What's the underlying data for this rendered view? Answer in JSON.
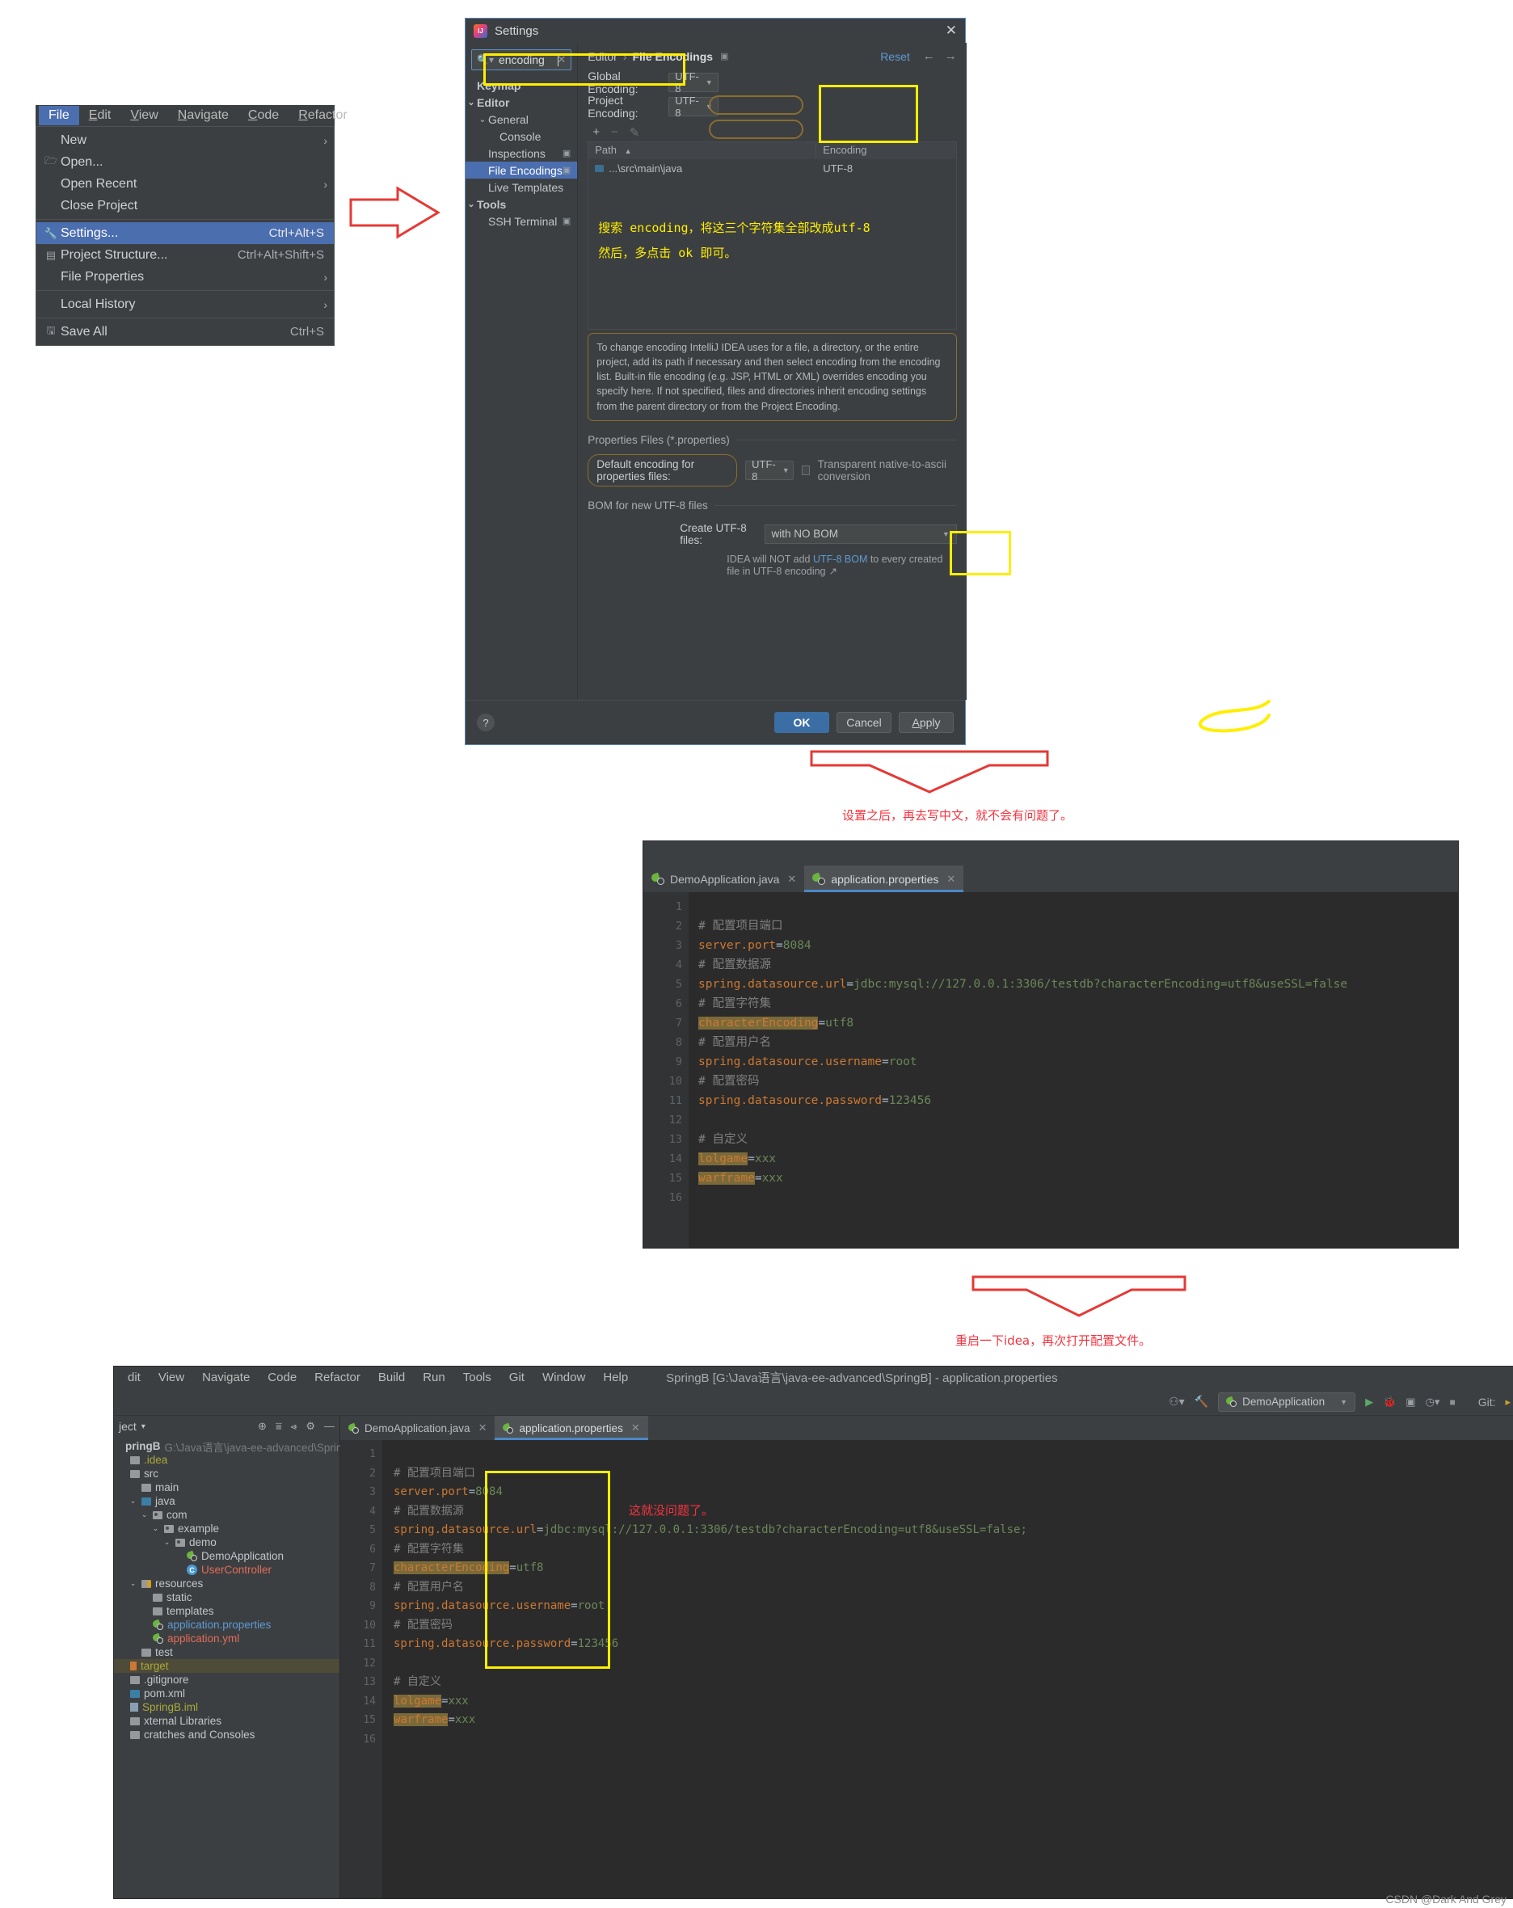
{
  "file_menu": {
    "menubar": [
      "File",
      "Edit",
      "View",
      "Navigate",
      "Code",
      "Refactor"
    ],
    "items": [
      {
        "label": "New",
        "accel": "",
        "arrow": "›",
        "icon": ""
      },
      {
        "label": "Open...",
        "accel": "",
        "arrow": "",
        "icon": "folder-open-icon"
      },
      {
        "label": "Open Recent",
        "accel": "",
        "arrow": "›",
        "icon": ""
      },
      {
        "label": "Close Project",
        "accel": "",
        "arrow": "",
        "icon": ""
      },
      {
        "label": "Settings...",
        "accel": "Ctrl+Alt+S",
        "arrow": "",
        "icon": "wrench-icon"
      },
      {
        "label": "Project Structure...",
        "accel": "Ctrl+Alt+Shift+S",
        "arrow": "",
        "icon": "module-icon"
      },
      {
        "label": "File Properties",
        "accel": "",
        "arrow": "›",
        "icon": ""
      },
      {
        "label": "Local History",
        "accel": "",
        "arrow": "›",
        "icon": ""
      },
      {
        "label": "Save All",
        "accel": "Ctrl+S",
        "arrow": "",
        "icon": "save-icon"
      }
    ]
  },
  "settings": {
    "title": "Settings",
    "close_label": "✕",
    "search": {
      "value": "encoding",
      "placeholder": "Search settings",
      "clear_label": "✕"
    },
    "tree": [
      {
        "label": "Keymap",
        "indent": 0,
        "chev": "",
        "bold": true,
        "selected": false,
        "trailing": ""
      },
      {
        "label": "Editor",
        "indent": 0,
        "chev": "⌄",
        "bold": true,
        "selected": false,
        "trailing": ""
      },
      {
        "label": "General",
        "indent": 1,
        "chev": "⌄",
        "bold": false,
        "selected": false,
        "trailing": ""
      },
      {
        "label": "Console",
        "indent": 2,
        "chev": "",
        "bold": false,
        "selected": false,
        "trailing": ""
      },
      {
        "label": "Inspections",
        "indent": 1,
        "chev": "",
        "bold": false,
        "selected": false,
        "trailing": "▣"
      },
      {
        "label": "File Encodings",
        "indent": 1,
        "chev": "",
        "bold": false,
        "selected": true,
        "trailing": "▣"
      },
      {
        "label": "Live Templates",
        "indent": 1,
        "chev": "",
        "bold": false,
        "selected": false,
        "trailing": ""
      },
      {
        "label": "Tools",
        "indent": 0,
        "chev": "⌄",
        "bold": true,
        "selected": false,
        "trailing": ""
      },
      {
        "label": "SSH Terminal",
        "indent": 1,
        "chev": "",
        "bold": false,
        "selected": false,
        "trailing": "▣"
      }
    ],
    "breadcrumb": {
      "crumb1": "Editor",
      "sep": "›",
      "crumb2": "File Encodings",
      "icon": "▣"
    },
    "reset_label": "Reset",
    "nav_back": "←",
    "nav_forward": "→",
    "global_encoding_label": "Global Encoding:",
    "global_encoding_value": "UTF-8",
    "project_encoding_label": "Project Encoding:",
    "project_encoding_value": "UTF-8",
    "table_toolbar": {
      "add": "+",
      "remove": "−",
      "edit": "✎"
    },
    "table": {
      "headers": [
        "Path",
        "Encoding"
      ],
      "sort_arrow": "▲",
      "rows": [
        {
          "path": "...\\src\\main\\java",
          "encoding": "UTF-8"
        }
      ]
    },
    "note_line1": "搜索 encoding，将这三个字符集全部改成utf-8",
    "note_line2": "然后，多点击 ok 即可。",
    "info_text": "To change encoding IntelliJ IDEA uses for a file, a directory, or the entire project, add its path if necessary and then select encoding from the encoding list. Built-in file encoding (e.g. JSP, HTML or XML) overrides encoding you specify here. If not specified, files and directories inherit encoding settings from the parent directory or from the Project Encoding.",
    "properties_section_title": "Properties Files (*.properties)",
    "default_properties_label": "Default encoding for properties files:",
    "default_properties_value": "UTF-8",
    "transparent_label": "Transparent native-to-ascii conversion",
    "bom_section_title": "BOM for new UTF-8 files",
    "create_utf8_label": "Create UTF-8 files:",
    "create_utf8_value": "with NO BOM",
    "bom_note_pre": "IDEA will NOT add ",
    "bom_note_link": "UTF-8 BOM",
    "bom_note_post": " to every created file in UTF-8 encoding",
    "bom_note_icon": "↗",
    "help_label": "?",
    "ok_label": "OK",
    "cancel_label": "Cancel",
    "apply_label": "Apply"
  },
  "annotations": {
    "after_settings": "设置之后，再去写中文，就不会有问题了。",
    "restart_idea": "重启一下idea，再次打开配置文件。",
    "no_problem": "这就没问题了。"
  },
  "mid_editor": {
    "tabs": [
      {
        "label": "DemoApplication.java",
        "icon": "spring-run-icon",
        "active": false,
        "close": "✕"
      },
      {
        "label": "application.properties",
        "icon": "spring-leaf-icon",
        "active": true,
        "close": "✕"
      }
    ],
    "line_numbers": [
      "1",
      "2",
      "3",
      "4",
      "5",
      "6",
      "7",
      "8",
      "9",
      "10",
      "11",
      "12",
      "13",
      "14",
      "15",
      "16"
    ],
    "lines": [
      {
        "n": 1,
        "type": "blank",
        "text": ""
      },
      {
        "n": 2,
        "type": "comment",
        "text": "# 配置项目端口"
      },
      {
        "n": 3,
        "type": "kv",
        "key": "server.port",
        "value": "8084",
        "highlight": false
      },
      {
        "n": 4,
        "type": "comment",
        "text": "# 配置数据源"
      },
      {
        "n": 5,
        "type": "kv",
        "key": "spring.datasource.url",
        "value": "jdbc:mysql://127.0.0.1:3306/testdb?characterEncoding=utf8&useSSL=false",
        "highlight": false
      },
      {
        "n": 6,
        "type": "comment",
        "text": "# 配置字符集"
      },
      {
        "n": 7,
        "type": "kv",
        "key": "characterEncoding",
        "value": "utf8",
        "highlight": true
      },
      {
        "n": 8,
        "type": "comment",
        "text": "# 配置用户名"
      },
      {
        "n": 9,
        "type": "kv",
        "key": "spring.datasource.username",
        "value": "root",
        "highlight": false
      },
      {
        "n": 10,
        "type": "comment",
        "text": "# 配置密码"
      },
      {
        "n": 11,
        "type": "kv",
        "key": "spring.datasource.password",
        "value": "123456",
        "highlight": false
      },
      {
        "n": 12,
        "type": "blank",
        "text": ""
      },
      {
        "n": 13,
        "type": "comment",
        "text": "# 自定义"
      },
      {
        "n": 14,
        "type": "kv",
        "key": "lolgame",
        "value": "xxx",
        "highlight": true
      },
      {
        "n": 15,
        "type": "kv",
        "key": "warframe",
        "value": "xxx",
        "highlight": true
      },
      {
        "n": 16,
        "type": "blank",
        "text": ""
      }
    ]
  },
  "ide": {
    "menubar": [
      "dit",
      "View",
      "Navigate",
      "Code",
      "Refactor",
      "Build",
      "Run",
      "Tools",
      "Git",
      "Window",
      "Help"
    ],
    "window_title": "SpringB [G:\\Java语言\\java-ee-advanced\\SpringB] - application.properties",
    "toolbar": {
      "vcs_icon": "vcs-icon",
      "build_icon": "hammer-icon",
      "run_config": "DemoApplication",
      "run_icon": "▶",
      "debug_icon": "🐞",
      "coverage_icon": "⚙",
      "stop_icon": "■",
      "git_label": "Git:"
    },
    "project_pane": {
      "title": "ject",
      "dropdown": "▾",
      "tool_icons": [
        "locate-icon",
        "expand-all-icon",
        "collapse-all-icon",
        "settings-gear-icon",
        "hide-icon"
      ],
      "tree": [
        {
          "label": "pringB",
          "sub": "G:\\Java语言\\java-ee-advanced\\SpringB",
          "indent": 0,
          "chev": "",
          "icon": "project-icon",
          "color": "white",
          "bold": true,
          "selected": false
        },
        {
          "label": ".idea",
          "sub": "",
          "indent": 0,
          "chev": "",
          "icon": "folder-grey",
          "color": "olive",
          "bold": false,
          "selected": false
        },
        {
          "label": "src",
          "sub": "",
          "indent": 0,
          "chev": "",
          "icon": "folder-grey",
          "color": "normal",
          "bold": false,
          "selected": false
        },
        {
          "label": "main",
          "sub": "",
          "indent": 1,
          "chev": "",
          "icon": "folder-grey",
          "color": "normal",
          "bold": false,
          "selected": false
        },
        {
          "label": "java",
          "sub": "",
          "indent": 1,
          "chev": "⌄",
          "icon": "folder-blue",
          "color": "normal",
          "bold": false,
          "selected": false
        },
        {
          "label": "com",
          "sub": "",
          "indent": 2,
          "chev": "⌄",
          "icon": "package",
          "color": "normal",
          "bold": false,
          "selected": false
        },
        {
          "label": "example",
          "sub": "",
          "indent": 3,
          "chev": "⌄",
          "icon": "package",
          "color": "normal",
          "bold": false,
          "selected": false
        },
        {
          "label": "demo",
          "sub": "",
          "indent": 4,
          "chev": "⌄",
          "icon": "package",
          "color": "normal",
          "bold": false,
          "selected": false
        },
        {
          "label": "DemoApplication",
          "sub": "",
          "indent": 5,
          "chev": "",
          "icon": "spring-run",
          "color": "normal",
          "bold": false,
          "selected": false
        },
        {
          "label": "UserController",
          "sub": "",
          "indent": 5,
          "chev": "",
          "icon": "class",
          "color": "red",
          "bold": false,
          "selected": false
        },
        {
          "label": "resources",
          "sub": "",
          "indent": 1,
          "chev": "⌄",
          "icon": "folder-res",
          "color": "normal",
          "bold": false,
          "selected": false
        },
        {
          "label": "static",
          "sub": "",
          "indent": 2,
          "chev": "",
          "icon": "folder-grey",
          "color": "normal",
          "bold": false,
          "selected": false
        },
        {
          "label": "templates",
          "sub": "",
          "indent": 2,
          "chev": "",
          "icon": "folder-grey",
          "color": "normal",
          "bold": false,
          "selected": false
        },
        {
          "label": "application.properties",
          "sub": "",
          "indent": 2,
          "chev": "",
          "icon": "spring-leaf",
          "color": "blue",
          "bold": false,
          "selected": false
        },
        {
          "label": "application.yml",
          "sub": "",
          "indent": 2,
          "chev": "",
          "icon": "spring-leaf",
          "color": "red",
          "bold": false,
          "selected": false
        },
        {
          "label": "test",
          "sub": "",
          "indent": 1,
          "chev": "",
          "icon": "folder-grey",
          "color": "normal",
          "bold": false,
          "selected": false
        },
        {
          "label": "target",
          "sub": "",
          "indent": 0,
          "chev": "",
          "icon": "folder-orange",
          "color": "olive",
          "bold": false,
          "selected": true
        },
        {
          "label": ".gitignore",
          "sub": "",
          "indent": 0,
          "chev": "",
          "icon": "git-file",
          "color": "normal",
          "bold": false,
          "selected": false
        },
        {
          "label": "pom.xml",
          "sub": "",
          "indent": 0,
          "chev": "",
          "icon": "maven-file",
          "color": "normal",
          "bold": false,
          "selected": false
        },
        {
          "label": "SpringB.iml",
          "sub": "",
          "indent": 0,
          "chev": "",
          "icon": "module-file",
          "color": "olive",
          "bold": false,
          "selected": false
        },
        {
          "label": "xternal Libraries",
          "sub": "",
          "indent": 0,
          "chev": "",
          "icon": "library",
          "color": "normal",
          "bold": false,
          "selected": false
        },
        {
          "label": "cratches and Consoles",
          "sub": "",
          "indent": 0,
          "chev": "",
          "icon": "scratch",
          "color": "normal",
          "bold": false,
          "selected": false
        }
      ]
    },
    "editor": {
      "tabs": [
        {
          "label": "DemoApplication.java",
          "icon": "spring-run-icon",
          "active": false,
          "close": "✕"
        },
        {
          "label": "application.properties",
          "icon": "spring-leaf-icon",
          "active": true,
          "close": "✕"
        }
      ],
      "lines": [
        {
          "n": 1,
          "type": "blank",
          "text": ""
        },
        {
          "n": 2,
          "type": "comment",
          "text": "# 配置项目端口"
        },
        {
          "n": 3,
          "type": "kv",
          "key": "server.port",
          "value": "8084",
          "highlight": false
        },
        {
          "n": 4,
          "type": "comment",
          "text": "# 配置数据源"
        },
        {
          "n": 5,
          "type": "kv",
          "key": "spring.datasource.url",
          "value": "jdbc:mysql://127.0.0.1:3306/testdb?characterEncoding=utf8&useSSL=false;",
          "highlight": false
        },
        {
          "n": 6,
          "type": "comment",
          "text": "# 配置字符集"
        },
        {
          "n": 7,
          "type": "kv",
          "key": "characterEncoding",
          "value": "utf8",
          "highlight": true
        },
        {
          "n": 8,
          "type": "comment",
          "text": "# 配置用户名"
        },
        {
          "n": 9,
          "type": "kv",
          "key": "spring.datasource.username",
          "value": "root",
          "highlight": false
        },
        {
          "n": 10,
          "type": "comment",
          "text": "# 配置密码"
        },
        {
          "n": 11,
          "type": "kv",
          "key": "spring.datasource.password",
          "value": "123456",
          "highlight": false
        },
        {
          "n": 12,
          "type": "blank",
          "text": ""
        },
        {
          "n": 13,
          "type": "comment",
          "text": "# 自定义"
        },
        {
          "n": 14,
          "type": "kv",
          "key": "lolgame",
          "value": "xxx",
          "highlight": true
        },
        {
          "n": 15,
          "type": "kv",
          "key": "warframe",
          "value": "xxx",
          "highlight": true
        },
        {
          "n": 16,
          "type": "blank",
          "text": ""
        }
      ]
    }
  },
  "watermark": "CSDN @Dark And Grey",
  "colors": {
    "accent_blue": "#4b6eaf",
    "highlight_yellow": "#ffee00",
    "annotation_red": "#f5333f",
    "pill_gold": "#8a6d2f"
  }
}
